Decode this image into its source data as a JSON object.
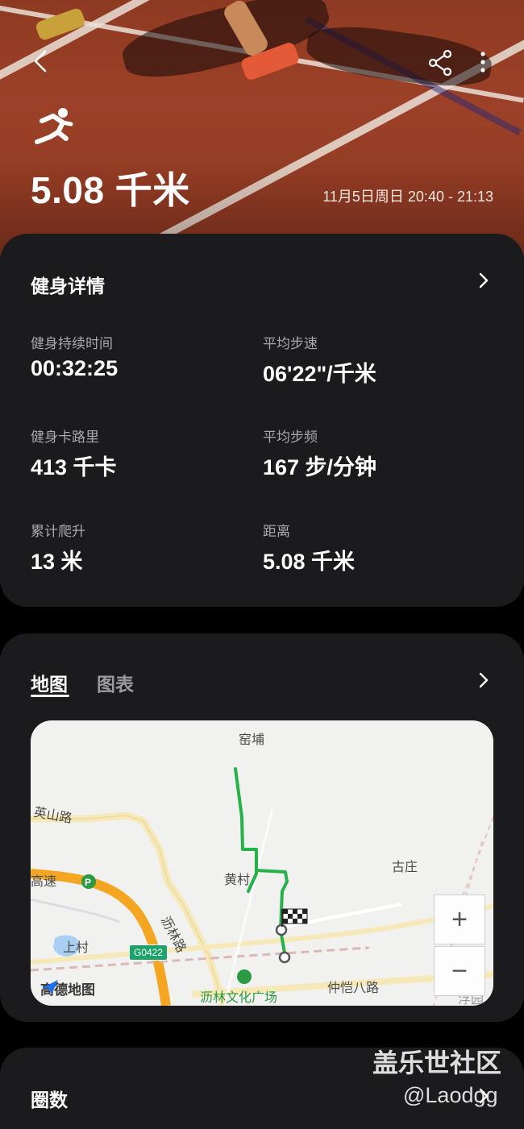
{
  "hero": {
    "distance": "5.08 千米",
    "datetime": "11月5日周日 20:40 - 21:13",
    "icons": {
      "back": "back-arrow-icon",
      "share": "share-icon",
      "more": "more-vert-icon",
      "activity": "running-icon"
    }
  },
  "details": {
    "title": "健身详情",
    "metrics": [
      {
        "label": "健身持续时间",
        "value": "00:32:25"
      },
      {
        "label": "平均步速",
        "value": "06'22\"/千米"
      },
      {
        "label": "健身卡路里",
        "value": "413 千卡"
      },
      {
        "label": "平均步频",
        "value": "167 步/分钟"
      },
      {
        "label": "累计爬升",
        "value": "13 米"
      },
      {
        "label": "距离",
        "value": "5.08 千米"
      }
    ]
  },
  "map_section": {
    "tabs": [
      "地图",
      "图表"
    ],
    "active_tab": "地图",
    "labels": {
      "north": "窑埔",
      "yingshan_road": "英山路",
      "huangcun": "黄村",
      "guzhuang": "古庄",
      "highway": "高速",
      "shangcun": "上村",
      "lilin_road": "沥林路",
      "road_code": "G0422",
      "plaza": "沥林文化广场",
      "zhongkai_road": "仲恺八路",
      "corner": "浮园"
    },
    "provider": "高德地图",
    "zoom_in": "+",
    "zoom_out": "−",
    "route_color": "#27b14b"
  },
  "laps": {
    "title": "圈数"
  },
  "watermark": {
    "site": "盖乐世社区",
    "handle": "@Laodgg"
  }
}
